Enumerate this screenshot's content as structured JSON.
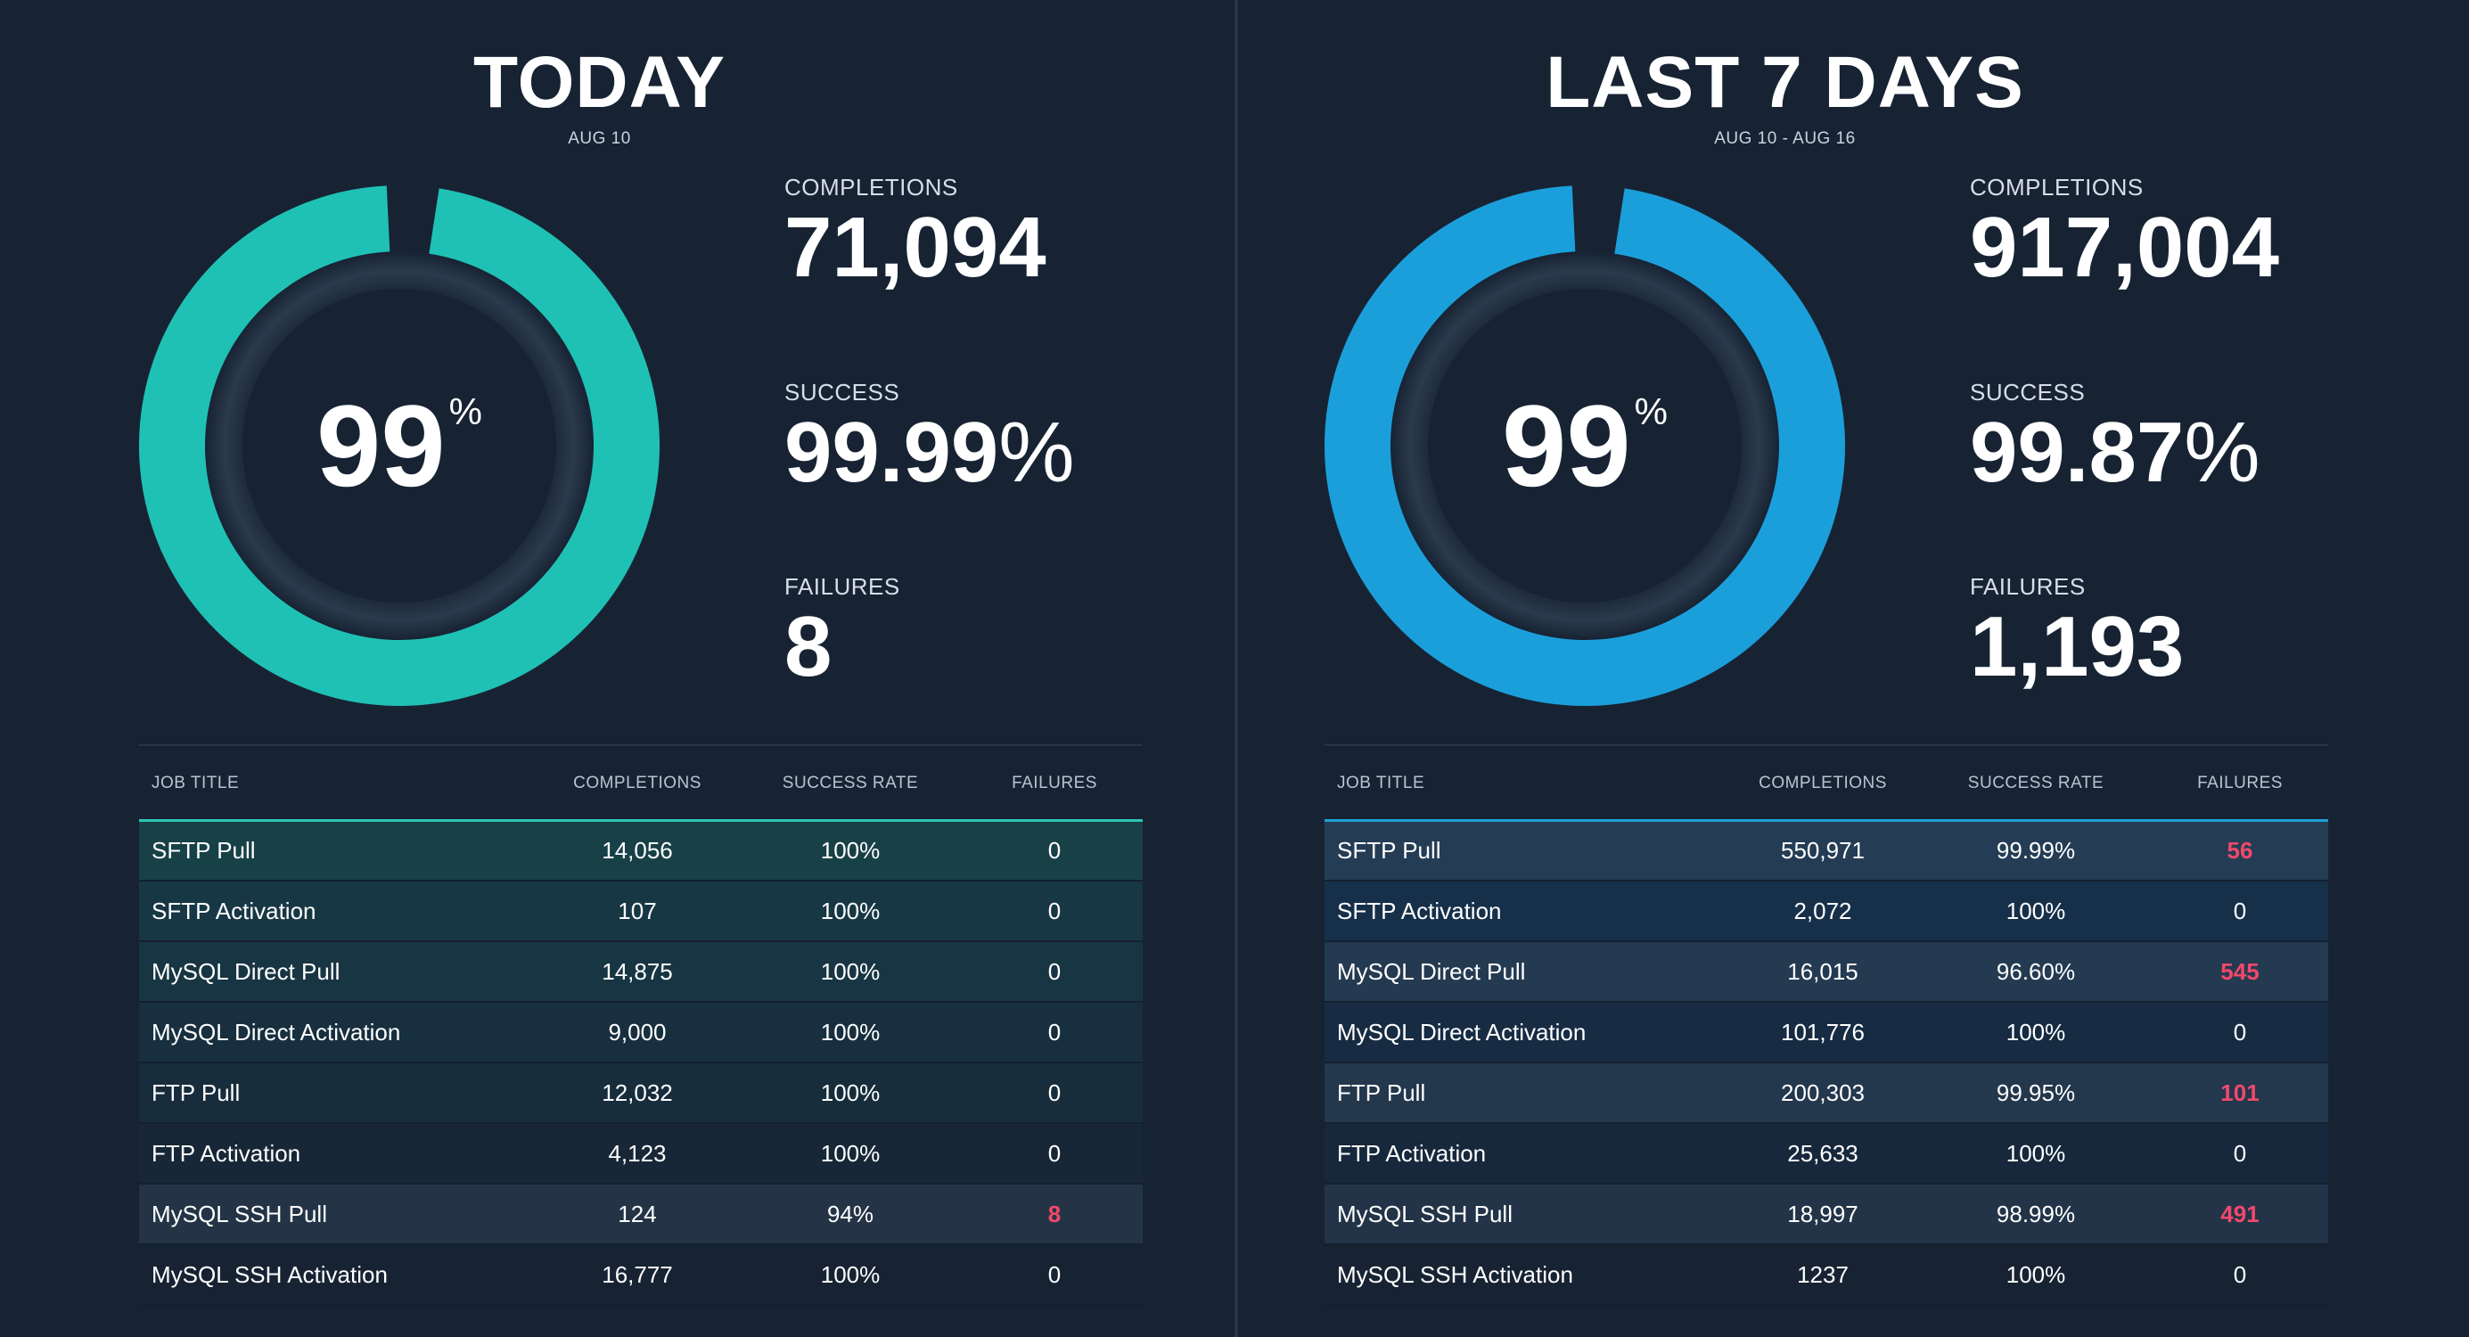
{
  "panels": [
    {
      "title": "TODAY",
      "date": "AUG 10",
      "accent": "#1fc1b5",
      "donut": {
        "value": "99",
        "unit": "%",
        "fraction": 0.99
      },
      "stats": {
        "completions_label": "COMPLETIONS",
        "completions": "71,094",
        "success_label": "SUCCESS",
        "success": "99.99",
        "success_unit": "%",
        "failures_label": "FAILURES",
        "failures": "8"
      },
      "table": {
        "headers": [
          "JOB TITLE",
          "COMPLETIONS",
          "SUCCESS RATE",
          "FAILURES"
        ],
        "rows": [
          {
            "title": "SFTP Pull",
            "completions": "14,056",
            "rate": "100%",
            "failures": "0",
            "bg": "#184047",
            "hot": false
          },
          {
            "title": "SFTP Activation",
            "completions": "107",
            "rate": "100%",
            "failures": "0",
            "bg": "#183745",
            "hot": false
          },
          {
            "title": "MySQL Direct Pull",
            "completions": "14,875",
            "rate": "100%",
            "failures": "0",
            "bg": "#183543",
            "hot": false
          },
          {
            "title": "MySQL Direct Activation",
            "completions": "9,000",
            "rate": "100%",
            "failures": "0",
            "bg": "#172f3e",
            "hot": false
          },
          {
            "title": "FTP Pull",
            "completions": "12,032",
            "rate": "100%",
            "failures": "0",
            "bg": "#172d3c",
            "hot": false
          },
          {
            "title": "FTP Activation",
            "completions": "4,123",
            "rate": "100%",
            "failures": "0",
            "bg": "#172737",
            "hot": false
          },
          {
            "title": "MySQL SSH Pull",
            "completions": "124",
            "rate": "94%",
            "failures": "8",
            "bg": "#243446",
            "hot": true
          },
          {
            "title": "MySQL SSH Activation",
            "completions": "16,777",
            "rate": "100%",
            "failures": "0",
            "bg": "#172333",
            "hot": false
          }
        ]
      }
    },
    {
      "title": "LAST 7 DAYS",
      "date": "AUG 10 - AUG 16",
      "accent": "#1b9fdb",
      "donut": {
        "value": "99",
        "unit": "%",
        "fraction": 0.99
      },
      "stats": {
        "completions_label": "COMPLETIONS",
        "completions": "917,004",
        "success_label": "SUCCESS",
        "success": "99.87",
        "success_unit": "%",
        "failures_label": "FAILURES",
        "failures": "1,193"
      },
      "table": {
        "headers": [
          "JOB TITLE",
          "COMPLETIONS",
          "SUCCESS RATE",
          "FAILURES"
        ],
        "rows": [
          {
            "title": "SFTP Pull",
            "completions": "550,971",
            "rate": "99.99%",
            "failures": "56",
            "bg": "#243d55",
            "hot": true
          },
          {
            "title": "SFTP Activation",
            "completions": "2,072",
            "rate": "100%",
            "failures": "0",
            "bg": "#17304a",
            "hot": false
          },
          {
            "title": "MySQL Direct Pull",
            "completions": "16,015",
            "rate": "96.60%",
            "failures": "545",
            "bg": "#243a51",
            "hot": true
          },
          {
            "title": "MySQL Direct Activation",
            "completions": "101,776",
            "rate": "100%",
            "failures": "0",
            "bg": "#172c43",
            "hot": false
          },
          {
            "title": "FTP Pull",
            "completions": "200,303",
            "rate": "99.95%",
            "failures": "101",
            "bg": "#23374d",
            "hot": true
          },
          {
            "title": "FTP Activation",
            "completions": "25,633",
            "rate": "100%",
            "failures": "0",
            "bg": "#17283c",
            "hot": false
          },
          {
            "title": "MySQL SSH Pull",
            "completions": "18,997",
            "rate": "98.99%",
            "failures": "491",
            "bg": "#233448",
            "hot": true
          },
          {
            "title": "MySQL SSH Activation",
            "completions": "1237",
            "rate": "100%",
            "failures": "0",
            "bg": "#172333",
            "hot": false
          }
        ]
      }
    }
  ]
}
